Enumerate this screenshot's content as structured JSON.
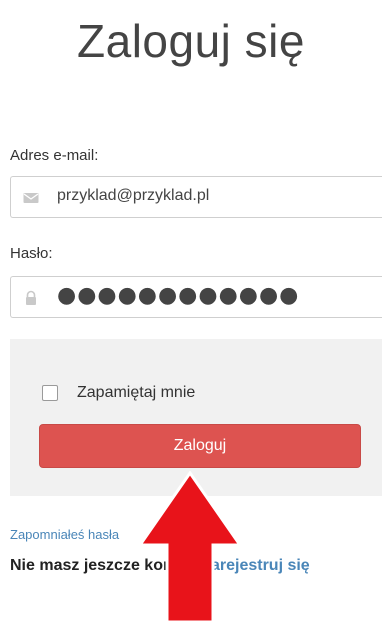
{
  "header": {
    "title": "Zaloguj się"
  },
  "form": {
    "email_label": "Adres e-mail:",
    "email_value": "przyklad@przyklad.pl",
    "password_label": "Hasło:",
    "password_masked": "●●●●●●●●●●●●",
    "remember_label": "Zapamiętaj mnie",
    "remember_checked": false,
    "submit_label": "Zaloguj"
  },
  "footer": {
    "forgot_text": "Zapomniałeś hasła",
    "register_prompt": "Nie masz jeszcze konta?",
    "register_link": "Zarejestruj się"
  },
  "icons": {
    "email": "envelope-icon",
    "password": "lock-icon",
    "annotation": "arrow-up-icon"
  },
  "colors": {
    "button": "#dd5350",
    "link": "#4a86b8",
    "arrow": "#e8131a",
    "panel": "#f1f1f1"
  }
}
